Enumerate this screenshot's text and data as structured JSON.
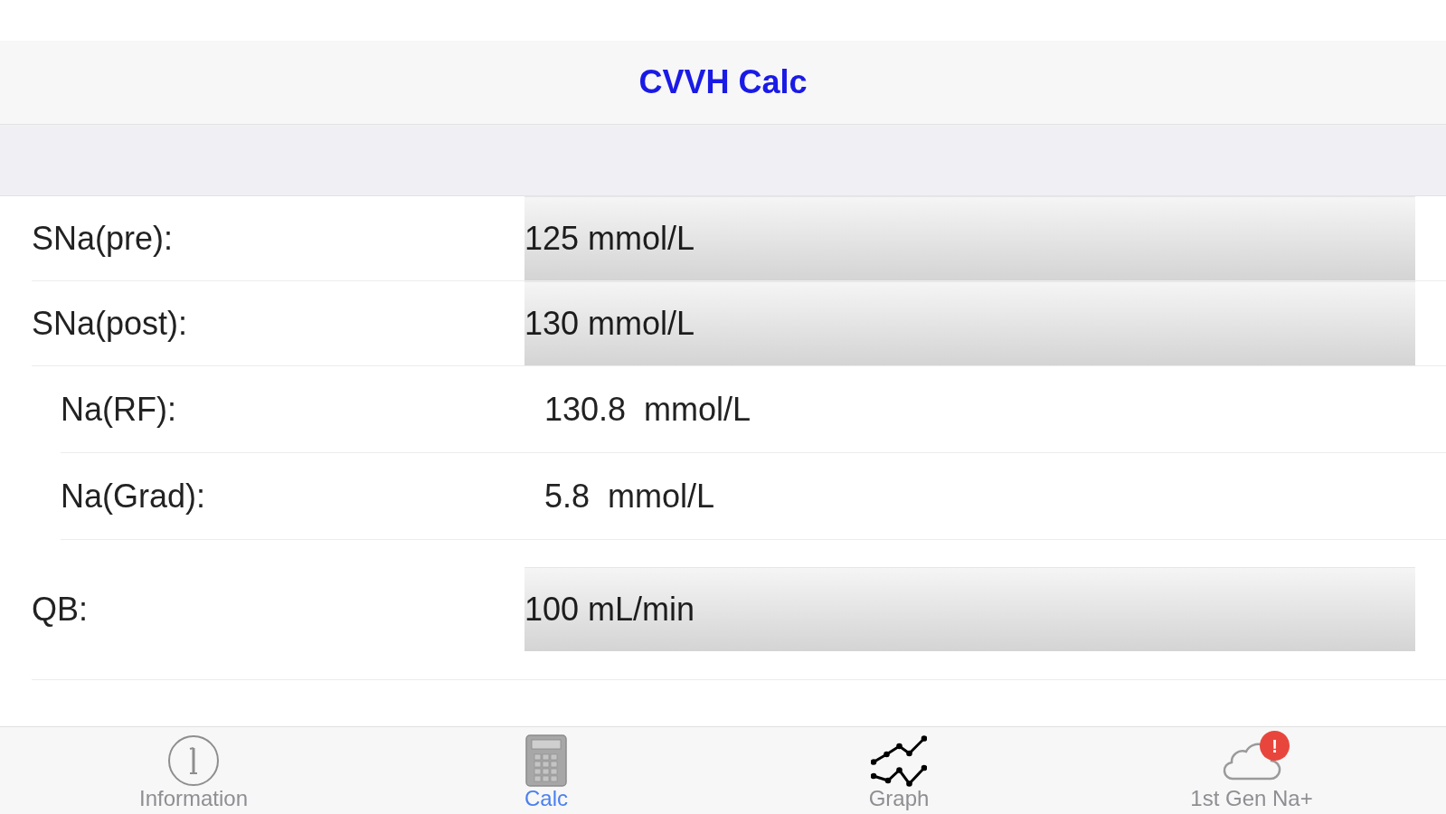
{
  "nav_bar": {
    "title": "CVVH Calc"
  },
  "sections": [
    {
      "rows": [
        {
          "kind": "input",
          "label": "SNa(pre):",
          "value": "125 mmol/L"
        },
        {
          "kind": "input",
          "label": "SNa(post):",
          "value": "130 mmol/L"
        },
        {
          "kind": "result",
          "label": "Na(RF):",
          "value": "130.8  mmol/L"
        },
        {
          "kind": "result",
          "label": "Na(Grad):",
          "value": "5.8  mmol/L"
        }
      ]
    },
    {
      "rows": [
        {
          "kind": "input",
          "label": "QB:",
          "value": "100 mL/min"
        }
      ]
    }
  ],
  "tab_bar": {
    "tabs": [
      {
        "label": "Information",
        "selected": false
      },
      {
        "label": "Calc",
        "selected": true
      },
      {
        "label": "Graph",
        "selected": false
      },
      {
        "label": "1st Gen Na+",
        "selected": false,
        "badge": "!"
      }
    ]
  }
}
